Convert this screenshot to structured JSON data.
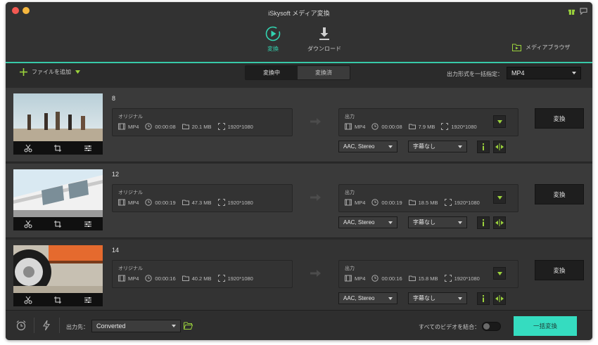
{
  "window": {
    "title": "iSkysoft メディア変換"
  },
  "toolbar": {
    "convert_label": "変換",
    "download_label": "ダウンロード",
    "media_browser_label": "メディアブラウザ"
  },
  "subbar": {
    "add_file_label": "ファイルを追加",
    "tab_converting": "変換中",
    "tab_converted": "変換済",
    "output_format_label": "出力形式を一括指定：",
    "output_format_value": "MP4"
  },
  "items": [
    {
      "title": "8",
      "original": {
        "label": "オリジナル",
        "format": "MP4",
        "duration": "00:00:08",
        "size": "20.1 MB",
        "resolution": "1920*1080"
      },
      "output": {
        "label": "出力",
        "format": "MP4",
        "duration": "00:00:08",
        "size": "7.9 MB",
        "resolution": "1920*1080"
      },
      "audio": "AAC, Stereo",
      "subtitle": "字幕なし",
      "convert_label": "変換"
    },
    {
      "title": "12",
      "original": {
        "label": "オリジナル",
        "format": "MP4",
        "duration": "00:00:19",
        "size": "47.3 MB",
        "resolution": "1920*1080"
      },
      "output": {
        "label": "出力",
        "format": "MP4",
        "duration": "00:00:19",
        "size": "18.5 MB",
        "resolution": "1920*1080"
      },
      "audio": "AAC, Stereo",
      "subtitle": "字幕なし",
      "convert_label": "変換"
    },
    {
      "title": "14",
      "original": {
        "label": "オリジナル",
        "format": "MP4",
        "duration": "00:00:16",
        "size": "40.2 MB",
        "resolution": "1920*1080"
      },
      "output": {
        "label": "出力",
        "format": "MP4",
        "duration": "00:00:16",
        "size": "15.8 MB",
        "resolution": "1920*1080"
      },
      "audio": "AAC, Stereo",
      "subtitle": "字幕なし",
      "convert_label": "変換"
    }
  ],
  "bottom": {
    "output_dest_label": "出力先：",
    "output_dest_value": "Converted",
    "merge_label": "すべてのビデオを結合：",
    "merge_enabled": false,
    "convert_all_label": "一括変換"
  },
  "colors": {
    "accent": "#35dcc0",
    "active_tab": "#32d4b1",
    "green_icon": "#9bd23c"
  },
  "icons": [
    "gift-icon",
    "chat-icon",
    "convert-icon",
    "download-icon",
    "folder-play-icon",
    "plus-icon",
    "scissors-icon",
    "crop-icon",
    "settings-icon",
    "film-icon",
    "clock-icon",
    "folder-icon",
    "resize-icon",
    "info-icon",
    "split-icon",
    "alarm-icon",
    "lightning-icon"
  ]
}
